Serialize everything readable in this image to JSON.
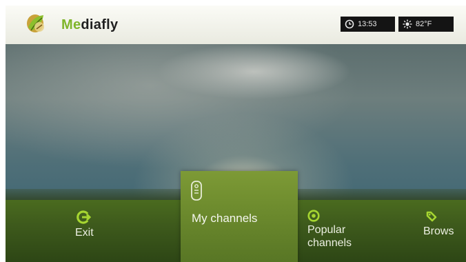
{
  "header": {
    "brand_prefix": "Me",
    "brand_suffix": "diafly",
    "time": "13:53",
    "temperature": "82°F",
    "logo_icon": "mediafly-leaf-logo",
    "clock_icon": "clock-icon",
    "weather_icon": "sun-icon"
  },
  "menu": {
    "items": [
      {
        "label": "Exit",
        "icon": "exit-arrow-icon"
      },
      {
        "label": "My channels",
        "icon": "remote-icon"
      },
      {
        "label_line1": "Popular",
        "label_line2": "channels",
        "icon": "popular-icon"
      },
      {
        "label": "Brows",
        "icon": "browse-icon"
      }
    ],
    "selected_index": 1
  },
  "colors": {
    "accent_green": "#7fb52a",
    "icon_green": "#a6d631",
    "menu_green": "#3e5a1c",
    "selected_green": "#6e8c2e"
  }
}
